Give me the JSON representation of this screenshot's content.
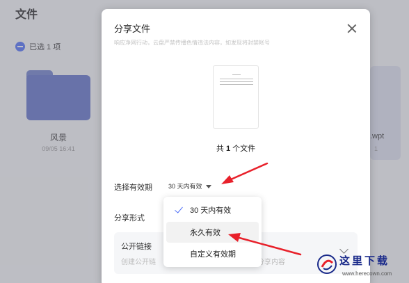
{
  "background": {
    "page_title": "文件",
    "selected_count": "已选 1 项",
    "folder": {
      "name": "风景",
      "date": "09/05 16:41"
    },
    "right_file": {
      "ext": ".wpt",
      "num": "1"
    }
  },
  "dialog": {
    "title": "分享文件",
    "subtitle": "响应净网行动，云盘严禁传播色情违法内容，如发现将封禁帐号",
    "file_count_prefix": "共 ",
    "file_count_number": "1",
    "file_count_suffix": " 个文件",
    "validity_label": "选择有效期",
    "validity_value": "30 天内有效",
    "share_form_label": "分享形式",
    "public_link": {
      "title": "公开链接",
      "desc_head": "创建公开链",
      "desc_tail": "分享内容"
    }
  },
  "dropdown": {
    "items": [
      {
        "label": "30 天内有效",
        "selected": true
      },
      {
        "label": "永久有效",
        "selected": false
      },
      {
        "label": "自定义有效期",
        "selected": false
      }
    ]
  },
  "watermark": {
    "text": "这里下载",
    "url": "www.herecown.com"
  },
  "colors": {
    "accent": "#4a6cf7",
    "annotation": "#e8202a"
  }
}
